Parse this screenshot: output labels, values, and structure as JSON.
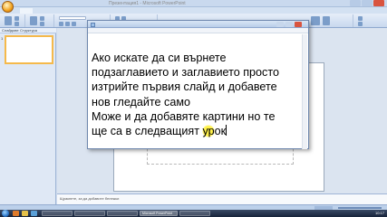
{
  "powerpoint": {
    "title": "Презентация1 - Microsoft PowerPoint",
    "left_pane_tabs": [
      "Слайдове",
      "Структура"
    ],
    "slide_number": "1",
    "notes_placeholder": "Щракнете, за да добавите бележки"
  },
  "notepad": {
    "lines": [
      "Ако искате да си върнете",
      "подзаглавието и заглавието просто",
      "изтрийте първия слайд и добавете",
      "нов гледайте само",
      "Може и да добавяте картини но те"
    ],
    "last_line_before": "ще са в следващият ",
    "last_line_highlight": "ур",
    "last_line_after": "ок"
  },
  "taskbar": {
    "buttons": [
      {
        "label": "Microsoft PowerPoint"
      }
    ],
    "clock": "10:17"
  },
  "colors": {
    "highlight": "#fff14a",
    "slide_selected_border": "#f5b94b",
    "taskbar": "#1f2d45"
  }
}
